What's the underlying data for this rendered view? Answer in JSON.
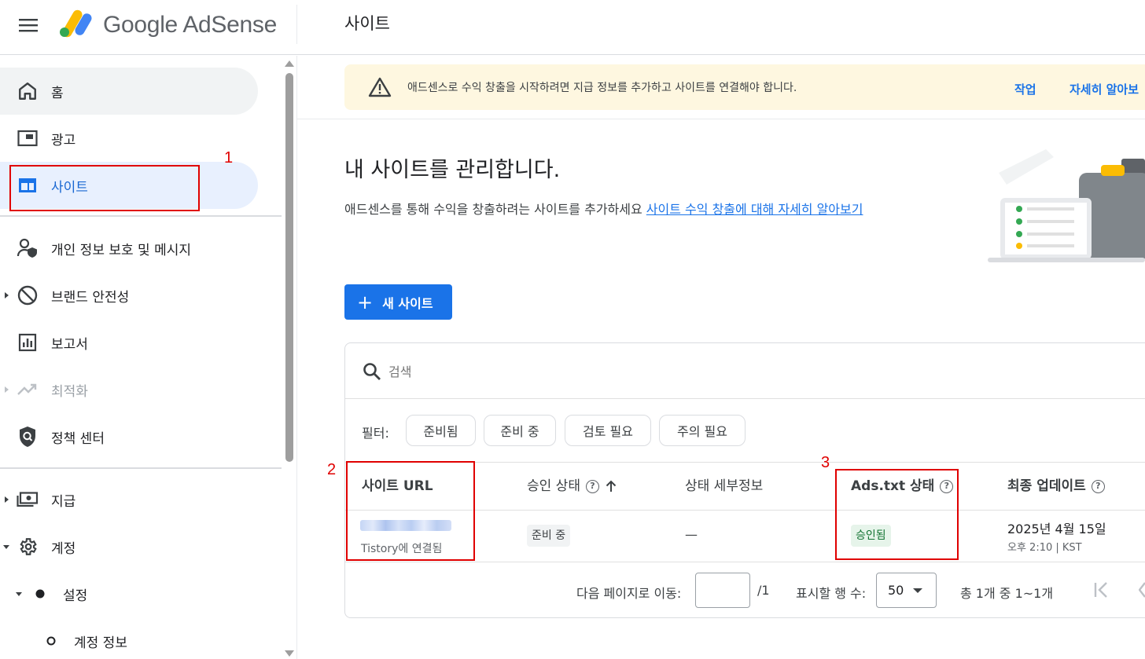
{
  "header": {
    "brand": "Google AdSense",
    "page_title": "사이트"
  },
  "sidebar": {
    "items": [
      {
        "label": "홈",
        "icon": "home-icon"
      },
      {
        "label": "광고",
        "icon": "ads-icon"
      },
      {
        "label": "사이트",
        "icon": "sites-icon"
      },
      {
        "label": "개인 정보 보호 및 메시지",
        "icon": "privacy-icon"
      },
      {
        "label": "브랜드 안전성",
        "icon": "block-icon"
      },
      {
        "label": "보고서",
        "icon": "reports-icon"
      },
      {
        "label": "최적화",
        "icon": "trending-icon"
      },
      {
        "label": "정책 센터",
        "icon": "policy-icon"
      },
      {
        "label": "지급",
        "icon": "payments-icon"
      },
      {
        "label": "계정",
        "icon": "gear-icon"
      },
      {
        "label": "설정",
        "icon": "dot-icon"
      },
      {
        "label": "계정 정보",
        "icon": "circle-icon"
      }
    ]
  },
  "banner": {
    "message": "애드센스로 수익 창출을 시작하려면 지급 정보를 추가하고 사이트를 연결해야 합니다.",
    "action_label": "작업",
    "learn_more_label": "자세히 알아보"
  },
  "hero": {
    "title": "내 사이트를 관리합니다.",
    "description": "애드센스를 통해 수익을 창출하려는 사이트를 추가하세요 ",
    "link_text": "사이트 수익 창출에 대해 자세히 알아보기"
  },
  "new_site_button": "새 사이트",
  "search": {
    "placeholder": "검색"
  },
  "filters": {
    "label": "필터:",
    "chips": [
      "준비됨",
      "준비 중",
      "검토 필요",
      "주의 필요"
    ]
  },
  "table": {
    "columns": [
      "사이트 URL",
      "승인 상태",
      "상태 세부정보",
      "Ads.txt 상태",
      "최종 업데이트"
    ],
    "rows": [
      {
        "site_sub": "Tistory에 연결됨",
        "approval": "준비 중",
        "details": "—",
        "ads_txt": "승인됨",
        "updated_date": "2025년 4월 15일",
        "updated_time": "오후 2:10 | KST"
      }
    ]
  },
  "pagination": {
    "goto_label": "다음 페이지로 이동:",
    "page_total": "/1",
    "rows_label": "표시할 행 수:",
    "rows_value": "50",
    "range": "총 1개 중 1~1개"
  },
  "annotations": [
    "1",
    "2",
    "3"
  ],
  "colors": {
    "accent": "#1a73e8",
    "banner_bg": "#fef7e0",
    "annotation": "#e00000",
    "approved_bg": "#e6f4ea",
    "approved_fg": "#137333"
  }
}
